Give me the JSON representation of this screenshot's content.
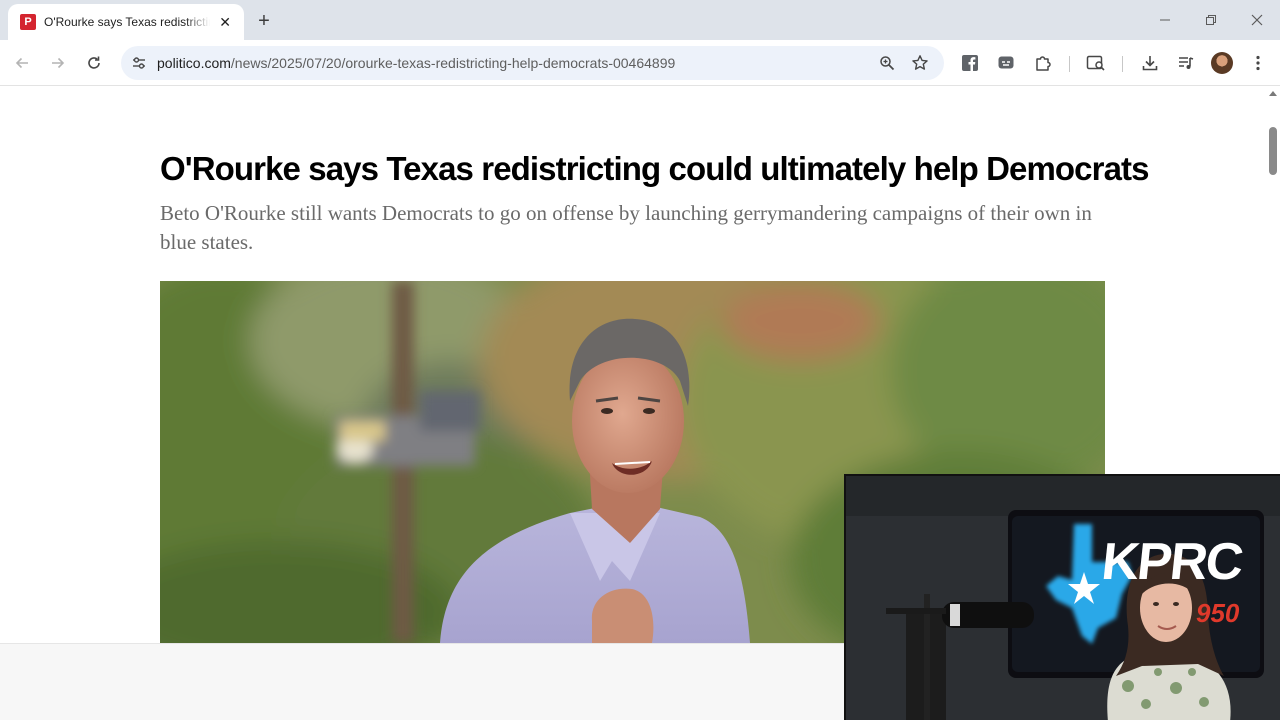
{
  "browser": {
    "tab": {
      "favicon_letter": "P",
      "title": "O'Rourke says Texas redistricting could ultimately help Democrats"
    },
    "address_bar": {
      "host": "politico.com",
      "path": "/news/2025/07/20/orourke-texas-redistricting-help-democrats-00464899"
    },
    "colors": {
      "tabstrip": "#dee3ea",
      "omnibox": "#edf2fa",
      "politico_red": "#d4242f"
    }
  },
  "article": {
    "headline": "O'Rourke says Texas redistricting could ultimately help Democrats",
    "dek": "Beto O'Rourke still wants Democrats to go on offense by launching gerrymandering campaigns of their own in blue states."
  },
  "webcam": {
    "station_call": "KPRC",
    "station_freq": "950"
  }
}
